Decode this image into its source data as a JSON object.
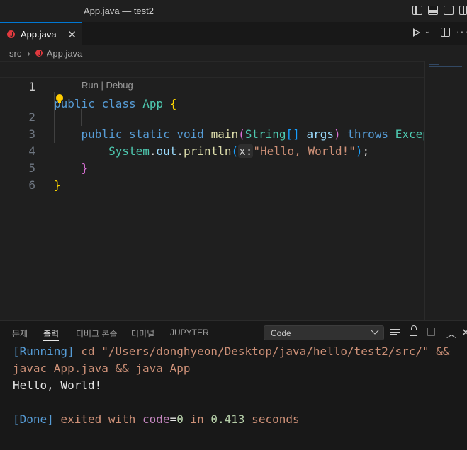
{
  "window": {
    "title": "App.java — test2"
  },
  "editor_tab": {
    "label": "App.java",
    "close": "✕"
  },
  "breadcrumb": {
    "folder": "src",
    "separator": "›",
    "file": "App.java"
  },
  "code": {
    "line_numbers": [
      "1",
      "2",
      "3",
      "4",
      "5",
      "6"
    ],
    "codelens": "Run | Debug",
    "line1": {
      "kw1": "public",
      "kw2": "class",
      "name": "App",
      "brace": "{"
    },
    "line2": {
      "kw1": "public",
      "kw2": "static",
      "kw3": "void",
      "fn": "main",
      "paren_open": "(",
      "type": "String",
      "brackets": "[]",
      "arg": "args",
      "paren_close": ")",
      "throws": "throws",
      "exc": "Excep"
    },
    "line3": {
      "obj": "System",
      "dot1": ".",
      "field": "out",
      "dot2": ".",
      "fn": "println",
      "paren_open": "(",
      "hint": "x:",
      "str": "\"Hello, World!\"",
      "paren_close": ")",
      "semi": ";"
    },
    "line4": {
      "brace": "}"
    },
    "line5": {
      "brace": "}"
    }
  },
  "panel": {
    "tabs": [
      "문제",
      "출력",
      "디버그 콘솔",
      "터미널",
      "JUPYTER"
    ],
    "active_tab": "출력",
    "channel_select": "Code",
    "output": {
      "line1": {
        "tag": "[Running]",
        "cmd": " cd \"/Users/donghyeon/Desktop/java/hello/test2/src/\" &&"
      },
      "line2": {
        "cmd": "javac App.java && java App"
      },
      "line3": {
        "text": "Hello, World!"
      },
      "line5": {
        "tag": "[Done]",
        "t1": " exited with ",
        "key": "code",
        "eq": "=",
        "code": "0",
        "t2": " in ",
        "secs": "0.413",
        "t3": " seconds"
      }
    }
  },
  "icons": {
    "java_file": "java-icon",
    "run": "play-icon",
    "split": "split-editor-icon",
    "more": "ellipsis-icon",
    "bulb": "lightbulb-icon"
  },
  "colors": {
    "keyword": "#569cd6",
    "type": "#4ec9b0",
    "function": "#dcdcaa",
    "variable": "#9cdcfe",
    "string": "#ce9178",
    "accent": "#0078d4"
  }
}
